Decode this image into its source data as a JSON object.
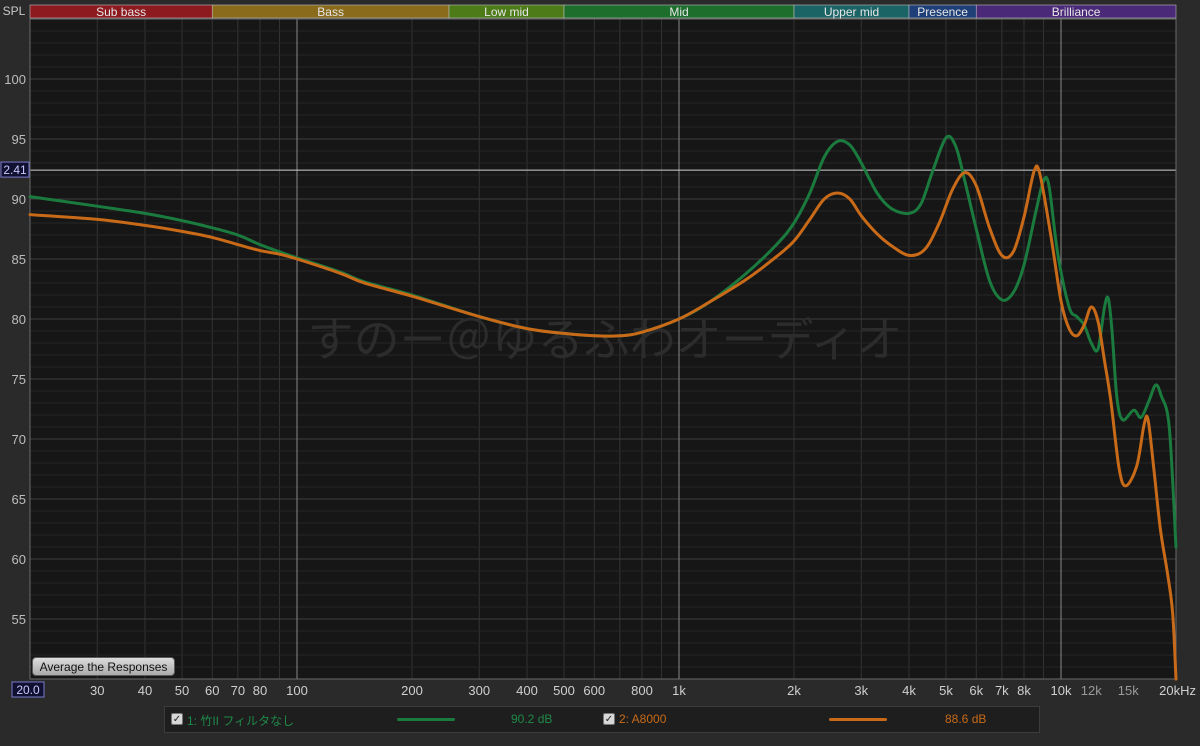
{
  "y_axis_label": "SPL",
  "cursor_value": "2.41",
  "x_start_value": "20.0",
  "watermark": "すのー＠ゆるふわオーディオ",
  "average_button_label": "Average the Responses",
  "bands": [
    {
      "label": "Sub bass",
      "from": 20,
      "to": 60,
      "color": "#8c1a1f"
    },
    {
      "label": "Bass",
      "from": 60,
      "to": 250,
      "color": "#8a6b1c"
    },
    {
      "label": "Low mid",
      "from": 250,
      "to": 500,
      "color": "#4d7b18"
    },
    {
      "label": "Mid",
      "from": 500,
      "to": 2000,
      "color": "#1d6e2c"
    },
    {
      "label": "Upper mid",
      "from": 2000,
      "to": 4000,
      "color": "#1b6466"
    },
    {
      "label": "Presence",
      "from": 4000,
      "to": 6000,
      "color": "#1e3f78"
    },
    {
      "label": "Brilliance",
      "from": 6000,
      "to": 20000,
      "color": "#4a2a78"
    }
  ],
  "legend": [
    {
      "index_label": "1: 竹II フィルタなし",
      "value": "90.2 dB",
      "color": "#1b7a3e",
      "checked": true
    },
    {
      "index_label": "2: A8000",
      "value": "88.6 dB",
      "color": "#c86a18",
      "checked": true
    }
  ],
  "chart_data": {
    "type": "line",
    "x_scale": "log",
    "xlim": [
      20,
      20000
    ],
    "ylim": [
      50,
      105
    ],
    "x_tick_labels": [
      "30",
      "40",
      "50",
      "60",
      "70",
      "80",
      "100",
      "200",
      "300",
      "400",
      "500",
      "600",
      "800",
      "1k",
      "2k",
      "3k",
      "4k",
      "5k",
      "6k",
      "7k",
      "8k",
      "10k",
      "12k",
      "15k",
      "20kHz"
    ],
    "x_tick_values": [
      30,
      40,
      50,
      60,
      70,
      80,
      100,
      200,
      300,
      400,
      500,
      600,
      800,
      1000,
      2000,
      3000,
      4000,
      5000,
      6000,
      7000,
      8000,
      10000,
      12000,
      15000,
      20000
    ],
    "y_ticks": [
      55,
      60,
      65,
      70,
      75,
      80,
      85,
      90,
      95,
      100
    ],
    "cursor_y": 92.41,
    "grid": true,
    "series": [
      {
        "name": "1: 竹II フィルタなし",
        "color": "#1b7a3e",
        "points": [
          [
            20,
            90.2
          ],
          [
            30,
            89.4
          ],
          [
            40,
            88.8
          ],
          [
            50,
            88.2
          ],
          [
            60,
            87.6
          ],
          [
            70,
            87
          ],
          [
            80,
            86.2
          ],
          [
            90,
            85.6
          ],
          [
            100,
            85.1
          ],
          [
            130,
            83.9
          ],
          [
            150,
            83.1
          ],
          [
            200,
            82
          ],
          [
            300,
            80.2
          ],
          [
            400,
            79.2
          ],
          [
            500,
            78.8
          ],
          [
            600,
            78.6
          ],
          [
            700,
            78.6
          ],
          [
            800,
            78.9
          ],
          [
            1000,
            80
          ],
          [
            1200,
            81.4
          ],
          [
            1500,
            83.8
          ],
          [
            1800,
            86.2
          ],
          [
            2000,
            88
          ],
          [
            2200,
            90.5
          ],
          [
            2400,
            93.5
          ],
          [
            2600,
            94.8
          ],
          [
            2800,
            94.5
          ],
          [
            3000,
            93
          ],
          [
            3300,
            90.5
          ],
          [
            3600,
            89.2
          ],
          [
            4000,
            88.8
          ],
          [
            4300,
            89.6
          ],
          [
            4600,
            92.2
          ],
          [
            5000,
            95.1
          ],
          [
            5300,
            94.4
          ],
          [
            5600,
            91.5
          ],
          [
            6000,
            87.5
          ],
          [
            6500,
            83.2
          ],
          [
            7000,
            81.6
          ],
          [
            7500,
            82.2
          ],
          [
            8000,
            84.5
          ],
          [
            8600,
            89
          ],
          [
            9000,
            91.5
          ],
          [
            9300,
            91.1
          ],
          [
            9800,
            85.5
          ],
          [
            10500,
            81
          ],
          [
            11000,
            80.2
          ],
          [
            11500,
            79.5
          ],
          [
            12000,
            78
          ],
          [
            12500,
            77.5
          ],
          [
            13000,
            81
          ],
          [
            13300,
            81.7
          ],
          [
            13600,
            79
          ],
          [
            14000,
            73.5
          ],
          [
            14500,
            71.6
          ],
          [
            15500,
            72.4
          ],
          [
            16200,
            71.8
          ],
          [
            17000,
            73.2
          ],
          [
            17700,
            74.5
          ],
          [
            18300,
            73.6
          ],
          [
            19200,
            71
          ],
          [
            20000,
            61
          ]
        ]
      },
      {
        "name": "2: A8000",
        "color": "#c86a18",
        "points": [
          [
            20,
            88.7
          ],
          [
            30,
            88.3
          ],
          [
            40,
            87.8
          ],
          [
            50,
            87.3
          ],
          [
            60,
            86.8
          ],
          [
            70,
            86.2
          ],
          [
            80,
            85.7
          ],
          [
            90,
            85.4
          ],
          [
            100,
            85
          ],
          [
            130,
            83.8
          ],
          [
            150,
            83
          ],
          [
            200,
            81.9
          ],
          [
            300,
            80.2
          ],
          [
            400,
            79.2
          ],
          [
            500,
            78.8
          ],
          [
            600,
            78.6
          ],
          [
            700,
            78.6
          ],
          [
            800,
            78.9
          ],
          [
            1000,
            80
          ],
          [
            1200,
            81.4
          ],
          [
            1500,
            83.3
          ],
          [
            1800,
            85.2
          ],
          [
            2000,
            86.5
          ],
          [
            2200,
            88.3
          ],
          [
            2400,
            90
          ],
          [
            2600,
            90.5
          ],
          [
            2800,
            90
          ],
          [
            3000,
            88.6
          ],
          [
            3300,
            87.1
          ],
          [
            3600,
            86.1
          ],
          [
            4000,
            85.3
          ],
          [
            4400,
            85.8
          ],
          [
            4800,
            88
          ],
          [
            5200,
            90.8
          ],
          [
            5600,
            92.2
          ],
          [
            6000,
            91.1
          ],
          [
            6500,
            87.6
          ],
          [
            7000,
            85.3
          ],
          [
            7500,
            85.6
          ],
          [
            8000,
            88.5
          ],
          [
            8500,
            92.3
          ],
          [
            8800,
            92.1
          ],
          [
            9400,
            87
          ],
          [
            10000,
            81.5
          ],
          [
            10500,
            79.2
          ],
          [
            11000,
            78.6
          ],
          [
            11500,
            79.5
          ],
          [
            12000,
            81
          ],
          [
            12500,
            79.8
          ],
          [
            13000,
            76.5
          ],
          [
            13500,
            73.2
          ],
          [
            14200,
            67.5
          ],
          [
            14800,
            66.1
          ],
          [
            15800,
            67.8
          ],
          [
            16500,
            71.2
          ],
          [
            16900,
            71.6
          ],
          [
            17500,
            67.5
          ],
          [
            18200,
            62.5
          ],
          [
            19000,
            58.8
          ],
          [
            19600,
            55.5
          ],
          [
            20000,
            50
          ]
        ]
      }
    ]
  }
}
